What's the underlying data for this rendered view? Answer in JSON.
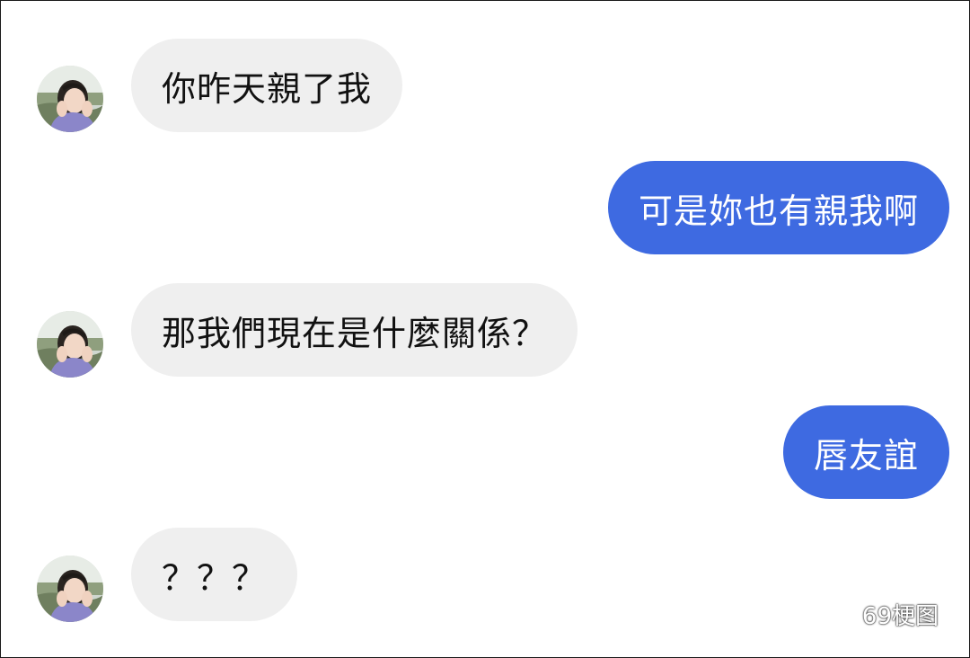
{
  "messages": [
    {
      "side": "in",
      "text": "你昨天親了我",
      "avatar": "woman-hands-on-cheeks"
    },
    {
      "side": "out",
      "text": "可是妳也有親我啊"
    },
    {
      "side": "in",
      "text": "那我們現在是什麼關係？",
      "avatar": "woman-hands-on-cheeks"
    },
    {
      "side": "out",
      "text": "唇友誼"
    },
    {
      "side": "in",
      "text": "？？？",
      "avatar": "woman-hands-on-cheeks"
    }
  ],
  "watermark": {
    "text": "69梗图",
    "icon": "wechat-icon"
  },
  "colors": {
    "incoming_bubble": "#efefef",
    "outgoing_bubble": "#3e6ae1",
    "incoming_text": "#111111",
    "outgoing_text": "#ffffff"
  }
}
